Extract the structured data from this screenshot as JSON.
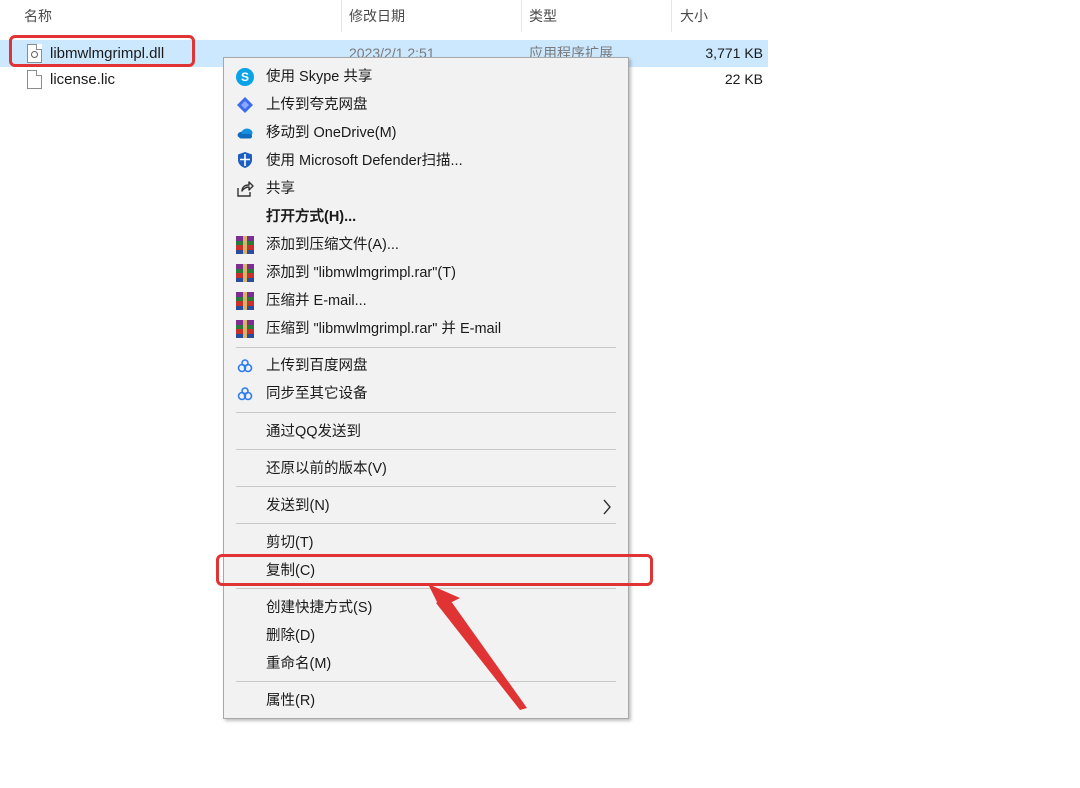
{
  "columns": {
    "name": "名称",
    "modified": "修改日期",
    "type": "类型",
    "size": "大小"
  },
  "files": [
    {
      "name": "libmwlmgrimpl.dll",
      "modified": "2023/2/1 2:51",
      "type": "应用程序扩展",
      "size": "3,771 KB",
      "selected": true,
      "icon": "dll-file-icon"
    },
    {
      "name": "license.lic",
      "modified": "",
      "type": "",
      "size": "22 KB",
      "selected": false,
      "icon": "file-icon"
    }
  ],
  "menu": {
    "items": [
      {
        "label": "使用 Skype 共享",
        "icon": "skype-icon"
      },
      {
        "label": "上传到夸克网盘",
        "icon": "quark-icon"
      },
      {
        "label": "移动到 OneDrive(M)",
        "icon": "onedrive-icon"
      },
      {
        "label": "使用 Microsoft Defender扫描...",
        "icon": "defender-shield-icon"
      },
      {
        "label": "共享",
        "icon": "share-icon"
      },
      {
        "label": "打开方式(H)...",
        "icon": ""
      },
      {
        "label": "添加到压缩文件(A)...",
        "icon": "winrar-icon"
      },
      {
        "label": "添加到 \"libmwlmgrimpl.rar\"(T)",
        "icon": "winrar-icon"
      },
      {
        "label": "压缩并 E-mail...",
        "icon": "winrar-icon"
      },
      {
        "label": "压缩到 \"libmwlmgrimpl.rar\" 并 E-mail",
        "icon": "winrar-icon"
      },
      {
        "label": "上传到百度网盘",
        "icon": "baidu-netdisk-icon"
      },
      {
        "label": "同步至其它设备",
        "icon": "baidu-netdisk-icon"
      },
      {
        "label": "通过QQ发送到",
        "icon": ""
      },
      {
        "label": "还原以前的版本(V)",
        "icon": ""
      },
      {
        "label": "发送到(N)",
        "icon": "",
        "submenu": true
      },
      {
        "label": "剪切(T)",
        "icon": ""
      },
      {
        "label": "复制(C)",
        "icon": "",
        "highlighted": true
      },
      {
        "label": "创建快捷方式(S)",
        "icon": ""
      },
      {
        "label": "删除(D)",
        "icon": ""
      },
      {
        "label": "重命名(M)",
        "icon": ""
      },
      {
        "label": "属性(R)",
        "icon": ""
      }
    ]
  },
  "colors": {
    "selection": "#cce8ff",
    "annotation_red": "#e03434",
    "menu_bg": "#f2f2f2",
    "skype_blue": "#0aa3e8",
    "onedrive_blue": "#0f6cbd"
  }
}
